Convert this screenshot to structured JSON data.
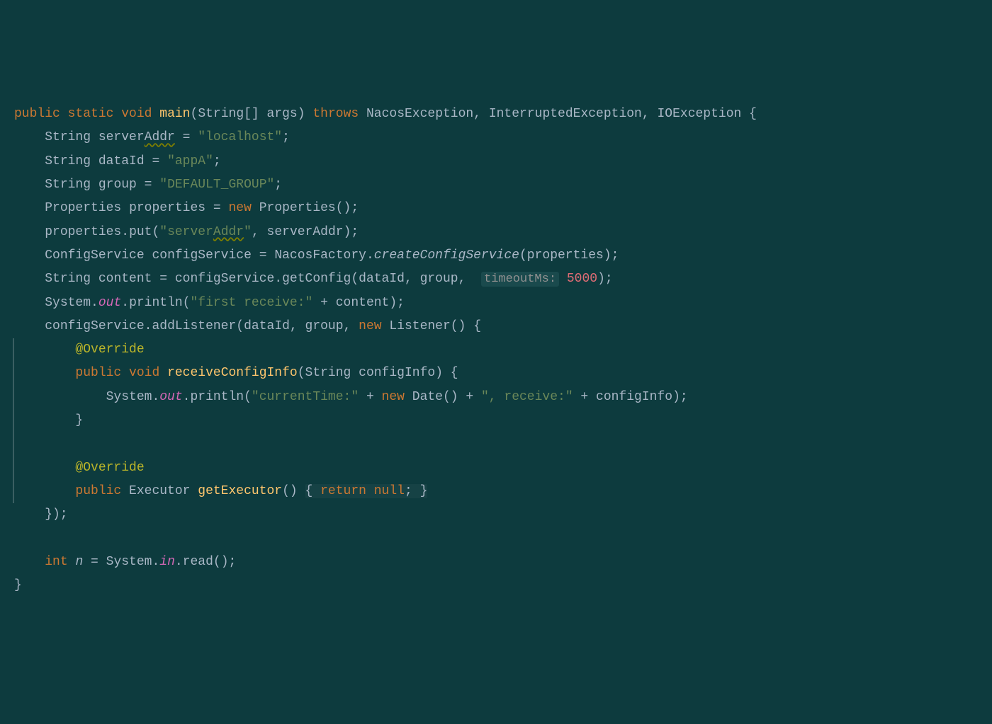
{
  "code": {
    "tokens": {
      "kw_public": "public",
      "kw_static": "static",
      "kw_void": "void",
      "kw_throws": "throws",
      "kw_new": "new",
      "kw_return": "return",
      "kw_null": "null",
      "kw_int": "int",
      "method_main": "main",
      "method_receiveConfigInfo": "receiveConfigInfo",
      "method_getExecutor": "getExecutor",
      "type_String": "String",
      "type_Properties": "Properties",
      "type_ConfigService": "ConfigService",
      "type_NacosFactory": "NacosFactory",
      "type_System": "System",
      "type_Listener": "Listener",
      "type_Date": "Date",
      "type_Executor": "Executor",
      "type_NacosException": "NacosException",
      "type_InterruptedException": "InterruptedException",
      "type_IOException": "IOException",
      "var_args": "args",
      "var_serverAddr": "serverAddr",
      "var_dataId": "dataId",
      "var_group": "group",
      "var_properties": "properties",
      "var_configService": "configService",
      "var_content": "content",
      "var_configInfo": "configInfo",
      "var_n": "n",
      "field_out": "out",
      "field_in": "in",
      "call_put": "put",
      "call_createConfigService": "createConfigService",
      "call_getConfig": "getConfig",
      "call_println": "println",
      "call_addListener": "addListener",
      "call_read": "read",
      "str_localhost": "\"localhost\"",
      "str_appA": "\"appA\"",
      "str_default_group": "\"DEFAULT_GROUP\"",
      "str_serverAddr": "\"serverAddr\"",
      "str_first_receive": "\"first receive:\"",
      "str_currentTime": "\"currentTime:\"",
      "str_receive": "\", receive:\"",
      "num_5000": "5000",
      "hint_timeoutMs": "timeoutMs:",
      "anno_override": "@Override"
    }
  }
}
